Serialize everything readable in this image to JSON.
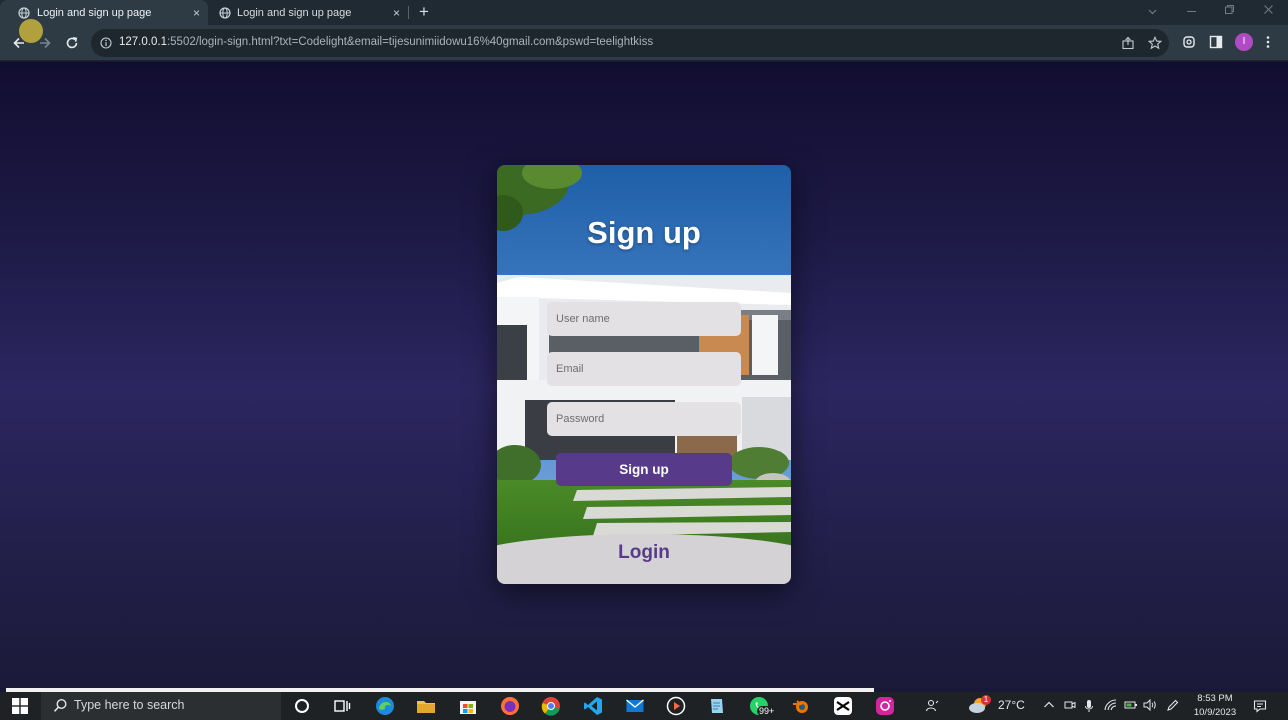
{
  "browser": {
    "tabs": [
      {
        "title": "Login and sign up page",
        "active": true
      },
      {
        "title": "Login and sign up page",
        "active": false
      }
    ],
    "new_tab_glyph": "+",
    "close_glyph": "×",
    "url_host": "127.0.0.1",
    "url_rest": ":5502/login-sign.html?txt=Codelight&email=tijesunimiidowu16%40gmail.com&pswd=teelightkiss",
    "profile_initial": "I"
  },
  "form": {
    "title": "Sign up",
    "username_placeholder": "User name",
    "email_placeholder": "Email",
    "password_placeholder": "Password",
    "submit_label": "Sign up",
    "login_label": "Login"
  },
  "colors": {
    "accent": "#573b8a",
    "field_bg": "#e3e1e3",
    "login_panel": "#d4d2d5"
  },
  "taskbar": {
    "search_placeholder": "Type here to search",
    "weather_temp": "27°C",
    "weather_badge": "1",
    "whatsapp_badge": "99+",
    "time": "8:53 PM",
    "date": "10/9/2023",
    "apps": [
      "cortana-icon",
      "task-view-icon",
      "edge-icon",
      "file-explorer-icon",
      "store-icon",
      "firefox-icon",
      "chrome-icon",
      "vscode-icon",
      "mail-icon",
      "media-player-icon",
      "notes-icon",
      "whatsapp-icon",
      "blender-icon",
      "capcut-icon",
      "instagram-icon"
    ]
  }
}
